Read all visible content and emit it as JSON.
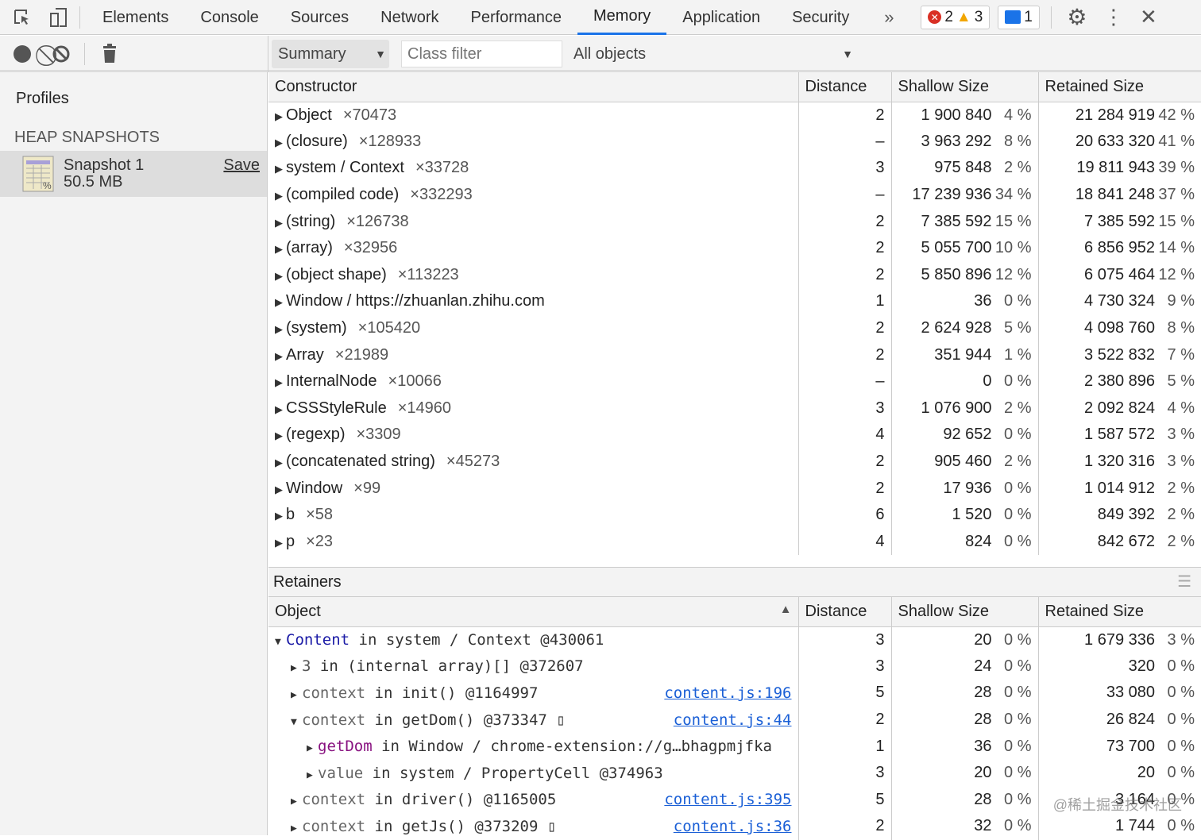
{
  "tabs": [
    "Elements",
    "Console",
    "Sources",
    "Network",
    "Performance",
    "Memory",
    "Application",
    "Security"
  ],
  "active_tab": "Memory",
  "errors": "2",
  "warnings": "3",
  "messages": "1",
  "toolbar": {
    "view": "Summary",
    "class_filter_placeholder": "Class filter",
    "objects_filter": "All objects"
  },
  "sidebar": {
    "title": "Profiles",
    "section": "HEAP SNAPSHOTS",
    "snapshot_name": "Snapshot 1",
    "snapshot_size": "50.5 MB",
    "save": "Save"
  },
  "columns": {
    "constructor": "Constructor",
    "distance": "Distance",
    "shallow": "Shallow Size",
    "retained": "Retained Size"
  },
  "rows": [
    [
      "Object",
      "×70473",
      "2",
      "1 900 840",
      "4 %",
      "21 284 919",
      "42 %"
    ],
    [
      "(closure)",
      "×128933",
      "–",
      "3 963 292",
      "8 %",
      "20 633 320",
      "41 %"
    ],
    [
      "system / Context",
      "×33728",
      "3",
      "975 848",
      "2 %",
      "19 811 943",
      "39 %"
    ],
    [
      "(compiled code)",
      "×332293",
      "–",
      "17 239 936",
      "34 %",
      "18 841 248",
      "37 %"
    ],
    [
      "(string)",
      "×126738",
      "2",
      "7 385 592",
      "15 %",
      "7 385 592",
      "15 %"
    ],
    [
      "(array)",
      "×32956",
      "2",
      "5 055 700",
      "10 %",
      "6 856 952",
      "14 %"
    ],
    [
      "(object shape)",
      "×113223",
      "2",
      "5 850 896",
      "12 %",
      "6 075 464",
      "12 %"
    ],
    [
      "Window / https://zhuanlan.zhihu.com",
      "",
      "1",
      "36",
      "0 %",
      "4 730 324",
      "9 %"
    ],
    [
      "(system)",
      "×105420",
      "2",
      "2 624 928",
      "5 %",
      "4 098 760",
      "8 %"
    ],
    [
      "Array",
      "×21989",
      "2",
      "351 944",
      "1 %",
      "3 522 832",
      "7 %"
    ],
    [
      "InternalNode",
      "×10066",
      "–",
      "0",
      "0 %",
      "2 380 896",
      "5 %"
    ],
    [
      "CSSStyleRule",
      "×14960",
      "3",
      "1 076 900",
      "2 %",
      "2 092 824",
      "4 %"
    ],
    [
      "(regexp)",
      "×3309",
      "4",
      "92 652",
      "0 %",
      "1 587 572",
      "3 %"
    ],
    [
      "(concatenated string)",
      "×45273",
      "2",
      "905 460",
      "2 %",
      "1 320 316",
      "3 %"
    ],
    [
      "Window",
      "×99",
      "2",
      "17 936",
      "0 %",
      "1 014 912",
      "2 %"
    ],
    [
      "b",
      "×58",
      "6",
      "1 520",
      "0 %",
      "849 392",
      "2 %"
    ],
    [
      "p",
      "×23",
      "4",
      "824",
      "0 %",
      "842 672",
      "2 %"
    ]
  ],
  "retainers": {
    "title": "Retainers",
    "object_col": "Object",
    "rows": [
      {
        "indent": 0,
        "open": true,
        "name": "Content",
        "rest": " in system / Context @430061",
        "link": "",
        "d": "3",
        "s": "20",
        "sp": "0 %",
        "r": "1 679 336",
        "rp": "3 %",
        "color": "#1a1aa6"
      },
      {
        "indent": 1,
        "open": false,
        "name": "3",
        "rest": " in (internal array)[] @372607",
        "link": "",
        "d": "3",
        "s": "24",
        "sp": "0 %",
        "r": "320",
        "rp": "0 %",
        "color": "#555"
      },
      {
        "indent": 1,
        "open": false,
        "name": "context",
        "rest": " in init() @1164997",
        "link": "content.js:196",
        "d": "5",
        "s": "28",
        "sp": "0 %",
        "r": "33 080",
        "rp": "0 %",
        "color": "#666"
      },
      {
        "indent": 1,
        "open": true,
        "name": "context",
        "rest": " in getDom() @373347 ▯",
        "link": "content.js:44",
        "d": "2",
        "s": "28",
        "sp": "0 %",
        "r": "26 824",
        "rp": "0 %",
        "color": "#666"
      },
      {
        "indent": 2,
        "open": false,
        "name": "getDom",
        "rest": " in Window / chrome-extension://g…bhagpmjfka",
        "link": "",
        "d": "1",
        "s": "36",
        "sp": "0 %",
        "r": "73 700",
        "rp": "0 %",
        "color": "#881280"
      },
      {
        "indent": 2,
        "open": false,
        "name": "value",
        "rest": " in system / PropertyCell @374963",
        "link": "",
        "d": "3",
        "s": "20",
        "sp": "0 %",
        "r": "20",
        "rp": "0 %",
        "color": "#666"
      },
      {
        "indent": 1,
        "open": false,
        "name": "context",
        "rest": " in driver() @1165005",
        "link": "content.js:395",
        "d": "5",
        "s": "28",
        "sp": "0 %",
        "r": "3 164",
        "rp": "0 %",
        "color": "#666"
      },
      {
        "indent": 1,
        "open": false,
        "name": "context",
        "rest": " in getJs() @373209 ▯",
        "link": "content.js:36",
        "d": "2",
        "s": "32",
        "sp": "0 %",
        "r": "1 744",
        "rp": "0 %",
        "color": "#666"
      }
    ]
  },
  "watermark": "@稀土掘金技术社区"
}
